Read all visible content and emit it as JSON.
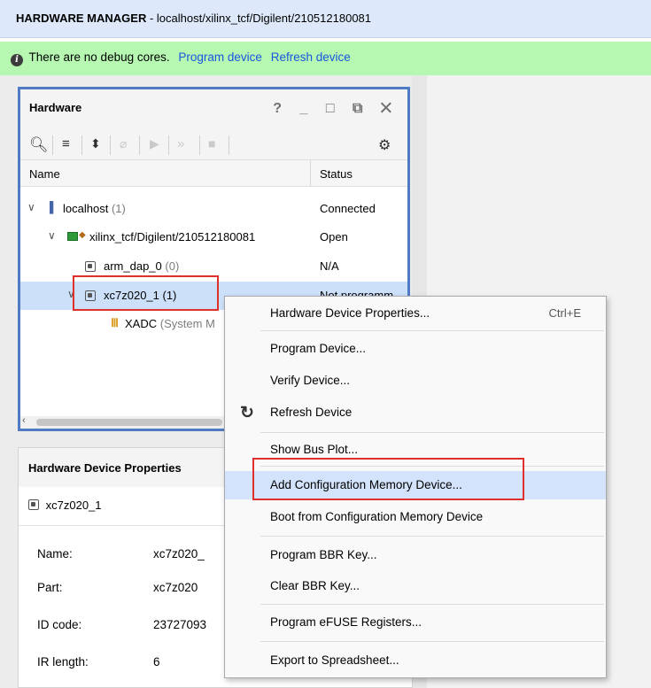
{
  "title_bar": {
    "prefix": "HARDWARE MANAGER",
    "path": " - localhost/xilinx_tcf/Digilent/210512180081"
  },
  "banner": {
    "message": "There are no debug cores.",
    "program_link": "Program device",
    "refresh_link": "Refresh device"
  },
  "hardware_panel": {
    "title": "Hardware",
    "window_buttons": "? _ □ ⧉ ✕",
    "columns": {
      "name": "Name",
      "status": "Status"
    },
    "rows": [
      {
        "label": "localhost",
        "count": "(1)",
        "status": "Connected"
      },
      {
        "label": "xilinx_tcf/Digilent/210512180081",
        "status": "Open"
      },
      {
        "label": "arm_dap_0",
        "count": "(0)",
        "status": "N/A"
      },
      {
        "label": "xc7z020_1 (1)",
        "status": "Not programm"
      },
      {
        "label": "XADC",
        "suffix": "(System M"
      }
    ]
  },
  "properties_panel": {
    "title": "Hardware Device Properties",
    "device": "xc7z020_1",
    "props": [
      {
        "name": "Name:",
        "value": "xc7z020_"
      },
      {
        "name": "Part:",
        "value": "xc7z020"
      },
      {
        "name": "ID code:",
        "value": "23727093"
      },
      {
        "name": "IR length:",
        "value": "6"
      }
    ]
  },
  "context_menu": {
    "items": [
      {
        "label": "Hardware Device Properties...",
        "shortcut": "Ctrl+E"
      },
      {
        "label": "Program Device..."
      },
      {
        "label": "Verify Device..."
      },
      {
        "label": "Refresh Device"
      },
      {
        "label": "Show Bus Plot..."
      },
      {
        "label": "Add Configuration Memory Device..."
      },
      {
        "label": "Boot from Configuration Memory Device"
      },
      {
        "label": "Program BBR Key..."
      },
      {
        "label": "Clear BBR Key..."
      },
      {
        "label": "Program eFUSE Registers..."
      },
      {
        "label": "Export to Spreadsheet..."
      }
    ]
  }
}
